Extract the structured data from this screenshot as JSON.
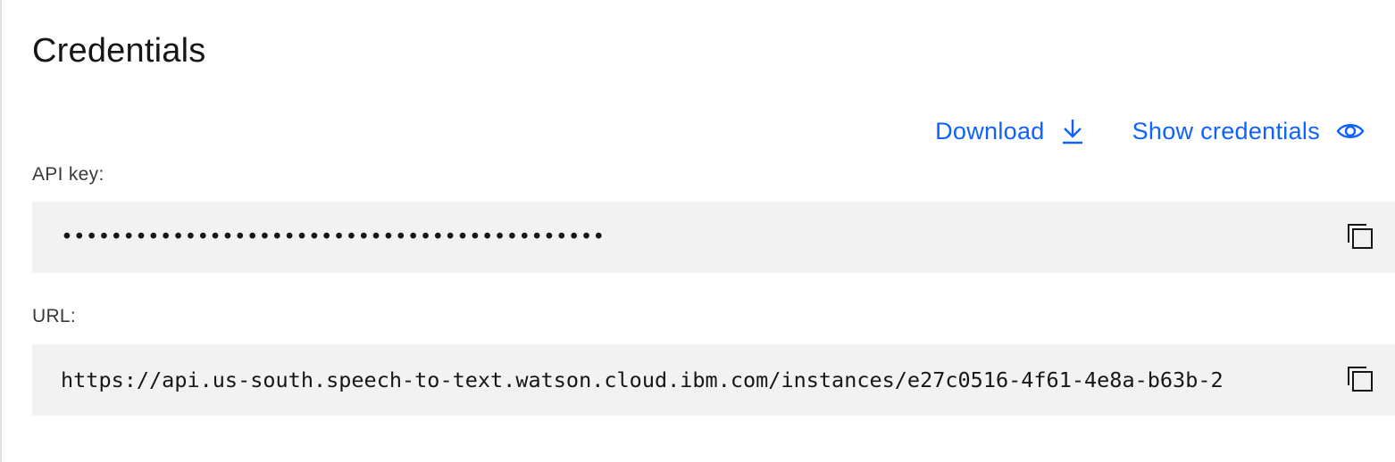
{
  "title": "Credentials",
  "actions": {
    "download_label": "Download",
    "download_icon": "download-icon",
    "show_credentials_label": "Show credentials",
    "show_credentials_icon": "eye-icon"
  },
  "api_key": {
    "label": "API key:",
    "value": "••••••••••••••••••••••••••••••••••••••••••••",
    "copy_icon": "copy-icon"
  },
  "url": {
    "label": "URL:",
    "value": "https://api.us-south.speech-to-text.watson.cloud.ibm.com/instances/e27c0516-4f61-4e8a-b63b-2",
    "copy_icon": "copy-icon"
  },
  "colors": {
    "link": "#0f62fe",
    "field_background": "#f2f2f2",
    "text": "#161616"
  }
}
